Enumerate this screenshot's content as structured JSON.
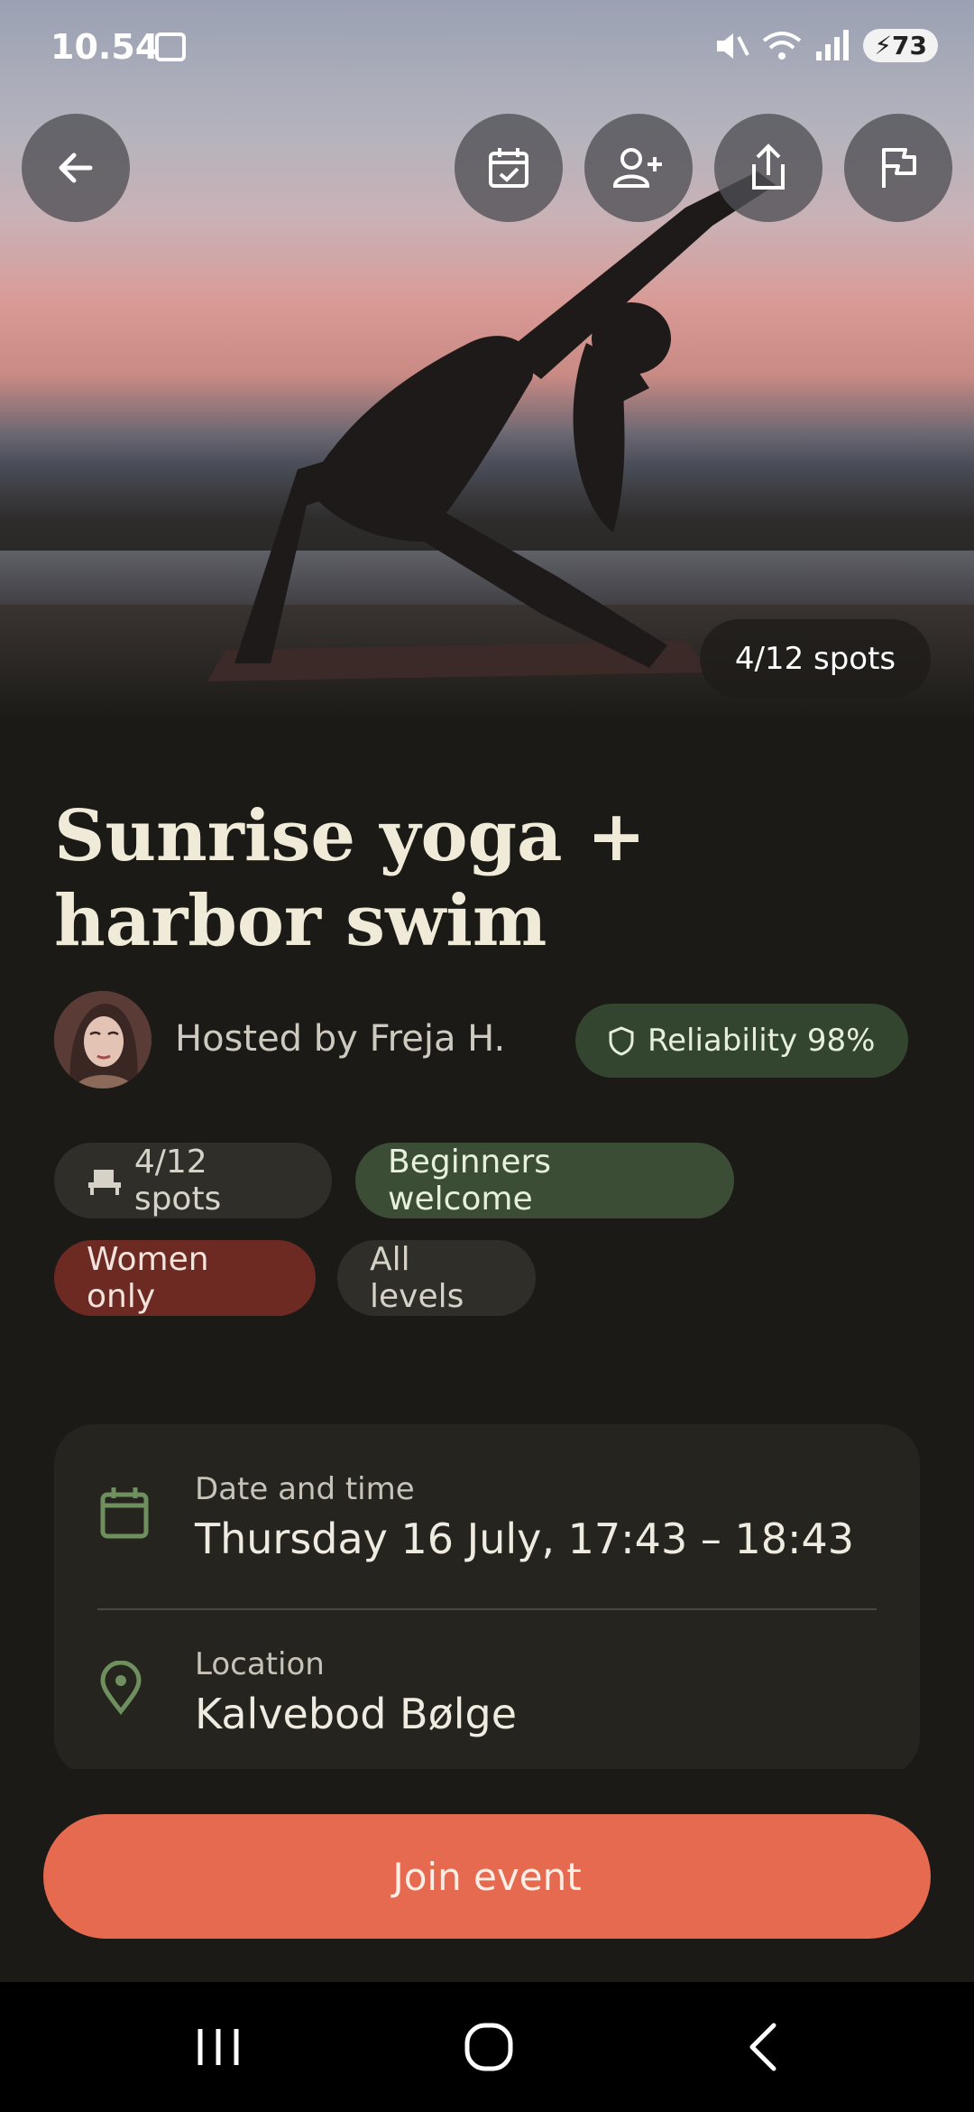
{
  "status_bar": {
    "time": "10.54",
    "battery": "73",
    "icons": [
      "screenshot-icon",
      "mute-icon",
      "wifi-icon",
      "signal-icon",
      "battery-icon"
    ]
  },
  "header": {
    "buttons": [
      "back-icon",
      "calendar-check-icon",
      "add-person-icon",
      "share-icon",
      "flag-icon"
    ]
  },
  "hero": {
    "spots_overlay": "4/12 spots"
  },
  "event": {
    "title": "Sunrise yoga + harbor swim",
    "host_text": "Hosted by Freja H.",
    "reliability": "Reliability 98%"
  },
  "tags": {
    "spots": "4/12 spots",
    "beginners": "Beginners welcome",
    "women": "Women only",
    "levels": "All levels"
  },
  "details": {
    "date_label": "Date and time",
    "date_value": "Thursday 16 July, 17:43 – 18:43",
    "location_label": "Location",
    "location_value": "Kalvebod Bølge"
  },
  "actions": {
    "join": "Join event"
  },
  "colors": {
    "accent": "#e56a50",
    "green_badge": "#3b4d35",
    "red_badge": "#6c2a22",
    "background": "#1b1a17"
  }
}
